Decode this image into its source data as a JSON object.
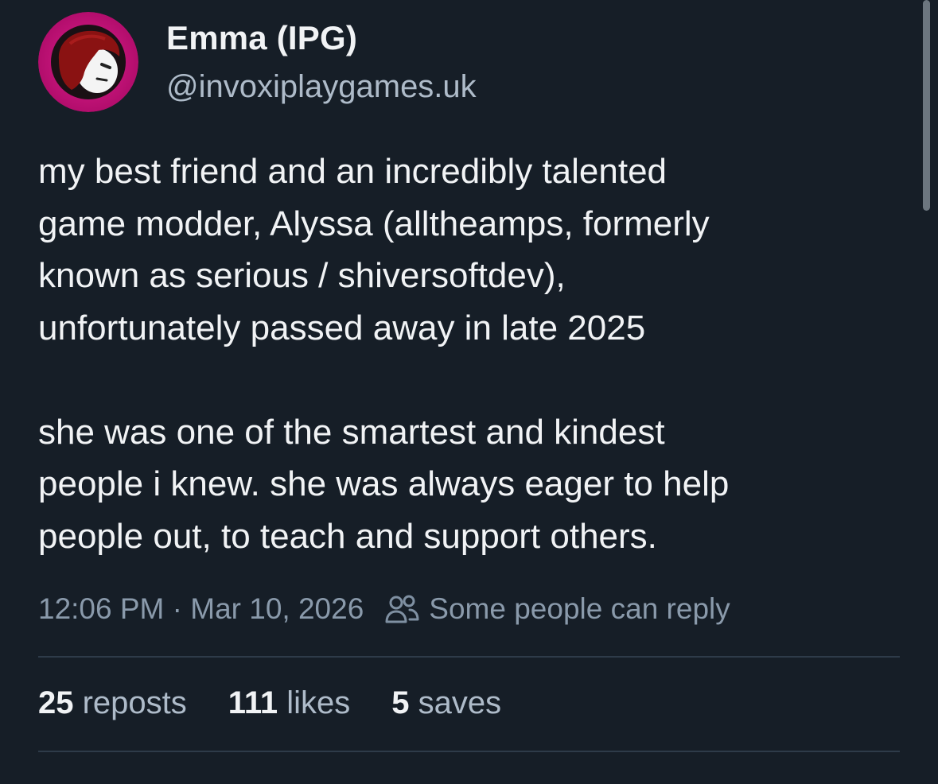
{
  "author": {
    "display_name": "Emma (IPG)",
    "handle": "@invoxiplaygames.uk",
    "avatar_icon": "avatar-red-hair-cartoon"
  },
  "post": {
    "paragraphs": [
      "my best friend and an incredibly talented\ngame modder, Alyssa (alltheamps, formerly\nknown as serious / shiversoftdev),\nunfortunately passed away in late 2025",
      "she was one of the smartest and kindest\npeople i knew. she was always eager to help\npeople out, to teach and support others."
    ],
    "time": "12:06 PM",
    "separator": "·",
    "date": "Mar 10, 2026",
    "reply_icon": "people-icon",
    "reply_setting": "Some people can reply"
  },
  "stats": {
    "reposts": {
      "count": "25",
      "label": "reposts"
    },
    "likes": {
      "count": "111",
      "label": "likes"
    },
    "saves": {
      "count": "5",
      "label": "saves"
    }
  },
  "colors": {
    "background": "#161e27",
    "text_primary": "#f1f3f5",
    "text_secondary": "#aebbc9",
    "meta_text": "#8a9aab",
    "divider": "#2e3b49",
    "avatar_ring": "#c8127a"
  }
}
